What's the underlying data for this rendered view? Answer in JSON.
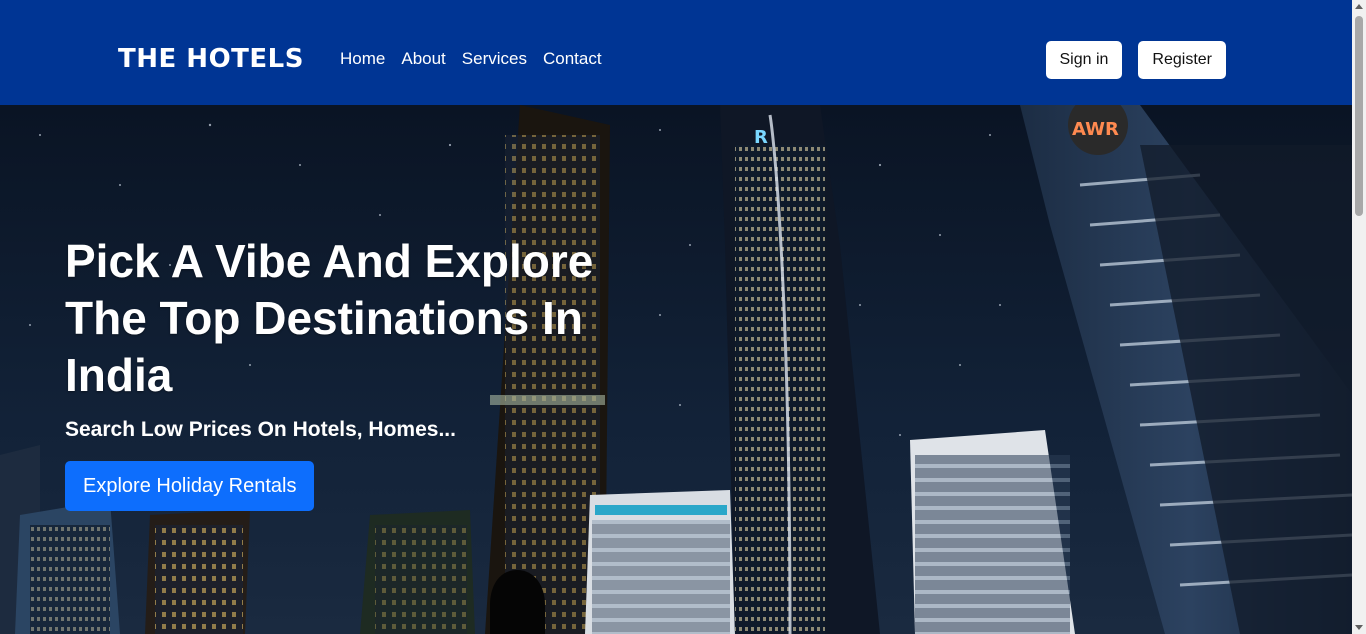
{
  "navbar": {
    "brand": "THE HOTELS",
    "links": [
      "Home",
      "About",
      "Services",
      "Contact"
    ],
    "sign_in": "Sign in",
    "register": "Register",
    "bg_color": "#003594"
  },
  "hero": {
    "title": "Pick A Vibe And Explore The Top Destinations In India",
    "subtitle": "Search Low Prices On Hotels, Homes...",
    "cta_label": "Explore Holiday Rentals",
    "cta_color": "#0d6efd",
    "background": "night city skyline with skyscrapers"
  }
}
